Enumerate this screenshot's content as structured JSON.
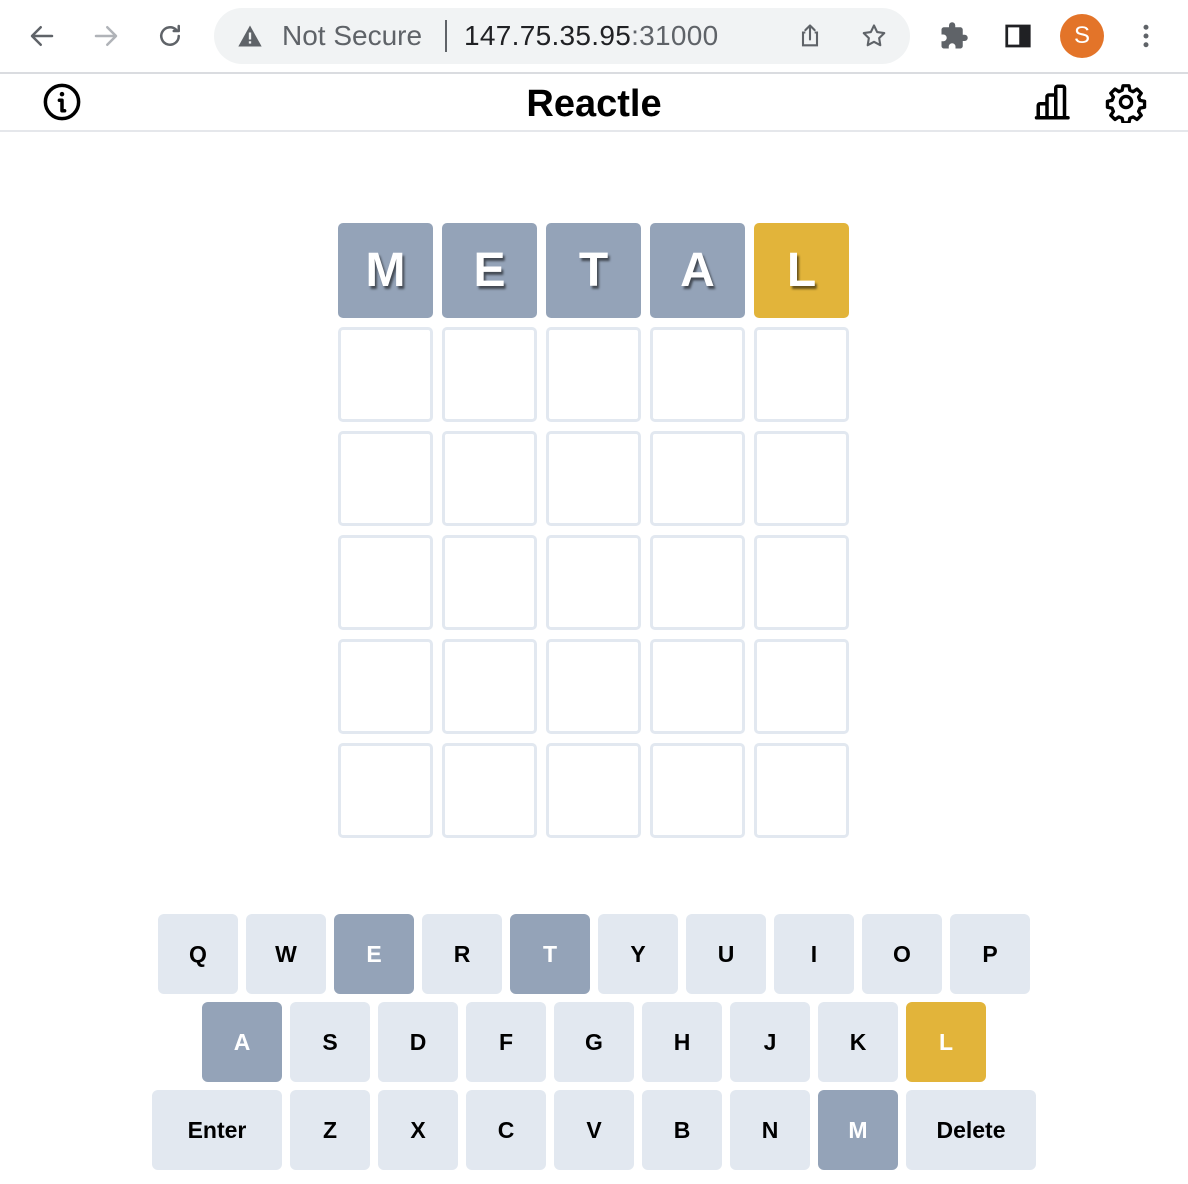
{
  "browser": {
    "security_label": "Not Secure",
    "url_host": "147.75.35.95",
    "url_port": ":31000",
    "profile_initial": "S"
  },
  "app": {
    "title": "Reactle"
  },
  "colors": {
    "absent": "#94a3b8",
    "present": "#e2b43a",
    "empty_border": "#e2e8f0",
    "key_default": "#e2e8f0"
  },
  "board": {
    "rows": [
      [
        {
          "letter": "M",
          "state": "absent"
        },
        {
          "letter": "E",
          "state": "absent"
        },
        {
          "letter": "T",
          "state": "absent"
        },
        {
          "letter": "A",
          "state": "absent"
        },
        {
          "letter": "L",
          "state": "present"
        }
      ],
      [
        {
          "letter": "",
          "state": "empty"
        },
        {
          "letter": "",
          "state": "empty"
        },
        {
          "letter": "",
          "state": "empty"
        },
        {
          "letter": "",
          "state": "empty"
        },
        {
          "letter": "",
          "state": "empty"
        }
      ],
      [
        {
          "letter": "",
          "state": "empty"
        },
        {
          "letter": "",
          "state": "empty"
        },
        {
          "letter": "",
          "state": "empty"
        },
        {
          "letter": "",
          "state": "empty"
        },
        {
          "letter": "",
          "state": "empty"
        }
      ],
      [
        {
          "letter": "",
          "state": "empty"
        },
        {
          "letter": "",
          "state": "empty"
        },
        {
          "letter": "",
          "state": "empty"
        },
        {
          "letter": "",
          "state": "empty"
        },
        {
          "letter": "",
          "state": "empty"
        }
      ],
      [
        {
          "letter": "",
          "state": "empty"
        },
        {
          "letter": "",
          "state": "empty"
        },
        {
          "letter": "",
          "state": "empty"
        },
        {
          "letter": "",
          "state": "empty"
        },
        {
          "letter": "",
          "state": "empty"
        }
      ],
      [
        {
          "letter": "",
          "state": "empty"
        },
        {
          "letter": "",
          "state": "empty"
        },
        {
          "letter": "",
          "state": "empty"
        },
        {
          "letter": "",
          "state": "empty"
        },
        {
          "letter": "",
          "state": "empty"
        }
      ]
    ]
  },
  "keyboard": {
    "rows": [
      [
        {
          "label": "Q",
          "state": "default"
        },
        {
          "label": "W",
          "state": "default"
        },
        {
          "label": "E",
          "state": "absent"
        },
        {
          "label": "R",
          "state": "default"
        },
        {
          "label": "T",
          "state": "absent"
        },
        {
          "label": "Y",
          "state": "default"
        },
        {
          "label": "U",
          "state": "default"
        },
        {
          "label": "I",
          "state": "default"
        },
        {
          "label": "O",
          "state": "default"
        },
        {
          "label": "P",
          "state": "default"
        }
      ],
      [
        {
          "label": "A",
          "state": "absent"
        },
        {
          "label": "S",
          "state": "default"
        },
        {
          "label": "D",
          "state": "default"
        },
        {
          "label": "F",
          "state": "default"
        },
        {
          "label": "G",
          "state": "default"
        },
        {
          "label": "H",
          "state": "default"
        },
        {
          "label": "J",
          "state": "default"
        },
        {
          "label": "K",
          "state": "default"
        },
        {
          "label": "L",
          "state": "present"
        }
      ],
      [
        {
          "label": "Enter",
          "state": "default",
          "wide": true
        },
        {
          "label": "Z",
          "state": "default"
        },
        {
          "label": "X",
          "state": "default"
        },
        {
          "label": "C",
          "state": "default"
        },
        {
          "label": "V",
          "state": "default"
        },
        {
          "label": "B",
          "state": "default"
        },
        {
          "label": "N",
          "state": "default"
        },
        {
          "label": "M",
          "state": "absent"
        },
        {
          "label": "Delete",
          "state": "default",
          "wide": true
        }
      ]
    ]
  }
}
